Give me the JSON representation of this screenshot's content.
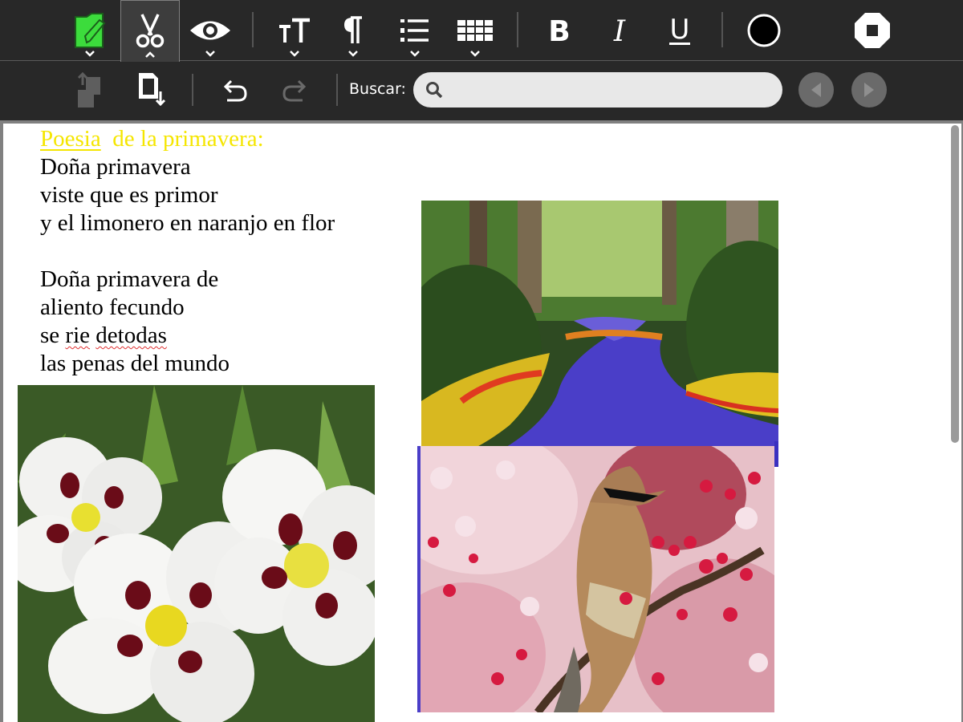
{
  "toolbar": {
    "buttons": [
      {
        "id": "activity",
        "icon": "document-edit-icon",
        "caret": "down"
      },
      {
        "id": "edit",
        "icon": "scissors-icon",
        "caret": "up",
        "active": true
      },
      {
        "id": "view",
        "icon": "eye-icon",
        "caret": "down"
      },
      {
        "id": "text",
        "icon": "text-size-icon",
        "caret": "down"
      },
      {
        "id": "paragraph",
        "icon": "pilcrow-icon",
        "caret": "down"
      },
      {
        "id": "list",
        "icon": "numbered-list-icon",
        "caret": "down"
      },
      {
        "id": "table",
        "icon": "table-icon",
        "caret": "down"
      },
      {
        "id": "bold",
        "icon": "bold-icon",
        "label": "B"
      },
      {
        "id": "italic",
        "icon": "italic-icon",
        "label": "I"
      },
      {
        "id": "underline",
        "icon": "underline-icon",
        "label": "U"
      },
      {
        "id": "color",
        "icon": "color-circle-icon",
        "color": "#000000"
      },
      {
        "id": "stop",
        "icon": "stop-icon"
      }
    ]
  },
  "edit_toolbar": {
    "search_label": "Buscar:",
    "search_value": "",
    "search_placeholder": ""
  },
  "document": {
    "title_words": [
      "Poesia",
      "de la primavera:"
    ],
    "stanza1": [
      "Doña primavera",
      "viste que es primor",
      "y el limonero en naranjo en flor"
    ],
    "stanza2_line1": "Doña primavera de",
    "stanza2_line2": "aliento fecundo",
    "stanza2_line3_parts": [
      "se ",
      "rie",
      " ",
      "detodas"
    ],
    "stanza2_line4": "las penas del mundo",
    "images": [
      "flower-path-garden",
      "white-cistus-flowers",
      "cedar-waxwing-bird-blossoms"
    ]
  },
  "colors": {
    "toolbar_bg": "#282828",
    "title_text": "#f5e600",
    "activity_icon": "#3cdc3c",
    "spell_underline": "#e03030"
  }
}
